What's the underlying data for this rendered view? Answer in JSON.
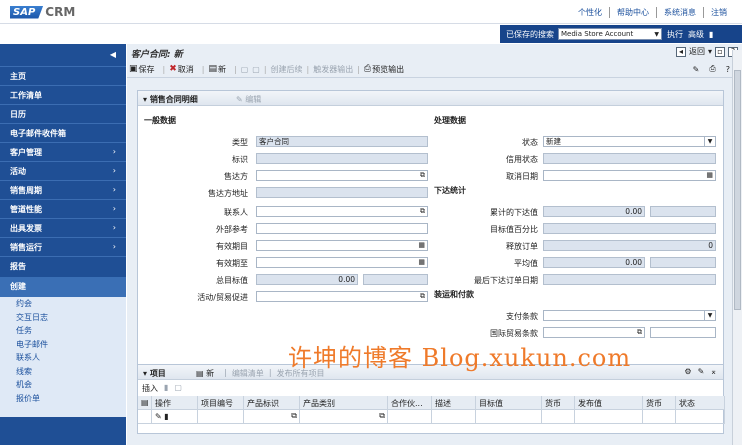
{
  "header": {
    "logo_sap": "SAP",
    "logo_crm": "CRM",
    "links": [
      "个性化",
      "帮助中心",
      "系统消息",
      "注销"
    ]
  },
  "search": {
    "label": "已保存的搜索",
    "selected": "Media Store Account",
    "execute": "执行",
    "advanced": "高级"
  },
  "nav": {
    "collapse": "◀",
    "items": [
      {
        "label": "主页",
        "chevron": false
      },
      {
        "label": "工作清单",
        "chevron": false
      },
      {
        "label": "日历",
        "chevron": false
      },
      {
        "label": "电子邮件收件箱",
        "chevron": false
      },
      {
        "label": "客户管理",
        "chevron": true
      },
      {
        "label": "活动",
        "chevron": true
      },
      {
        "label": "销售周期",
        "chevron": true
      },
      {
        "label": "管道性能",
        "chevron": true
      },
      {
        "label": "出具发票",
        "chevron": true
      },
      {
        "label": "销售运行",
        "chevron": true
      },
      {
        "label": "报告",
        "chevron": false
      }
    ],
    "create": {
      "title": "创建",
      "items": [
        "约会",
        "交互日志",
        "任务",
        "电子邮件",
        "联系人",
        "线索",
        "机会",
        "报价单"
      ]
    }
  },
  "page": {
    "title": "客户合同: 新",
    "back": "返回",
    "toolbar": {
      "save": "保存",
      "cancel": "取消",
      "new": "新",
      "create_followup": "创建后续",
      "trigger_output": "触发器输出",
      "preview_output": "预览输出"
    }
  },
  "detail": {
    "title": "销售合同明细",
    "edit": "编辑",
    "general": {
      "title": "一般数据",
      "type_label": "类型",
      "type_value": "客户合同",
      "id_label": "标识",
      "soldto_label": "售达方",
      "soldto_addr_label": "售达方地址",
      "contact_label": "联系人",
      "extref_label": "外部参考",
      "validfrom_label": "有效期目",
      "validto_label": "有效期至",
      "target_label": "总目标值",
      "target_value": "0.00",
      "campaign_label": "活动/贸易促进"
    },
    "processing": {
      "title": "处理数据",
      "status_label": "状态",
      "status_value": "新建",
      "credit_label": "信用状态",
      "cancel_date_label": "取消日期"
    },
    "release": {
      "title": "下达统计",
      "cum_label": "累计的下达值",
      "cum_value": "0.00",
      "pct_label": "目标值百分比",
      "orders_label": "释放订单",
      "orders_value": "0",
      "avg_label": "平均值",
      "avg_value": "0.00",
      "last_label": "最后下达订单日期"
    },
    "shipping": {
      "title": "装运和付款",
      "payment_label": "支付条款",
      "incoterms_label": "国际贸易条款"
    }
  },
  "watermark": "许坤的博客 Blog.xukun.com",
  "items": {
    "title": "项目",
    "new": "新",
    "edit_list": "编辑清单",
    "publish_all": "发布所有项目",
    "insert": "插入",
    "columns": [
      "操作",
      "项目编号",
      "产品标识",
      "产品类别",
      "合作伙...",
      "描述",
      "目标值",
      "货币",
      "发布值",
      "货币",
      "状态"
    ]
  }
}
